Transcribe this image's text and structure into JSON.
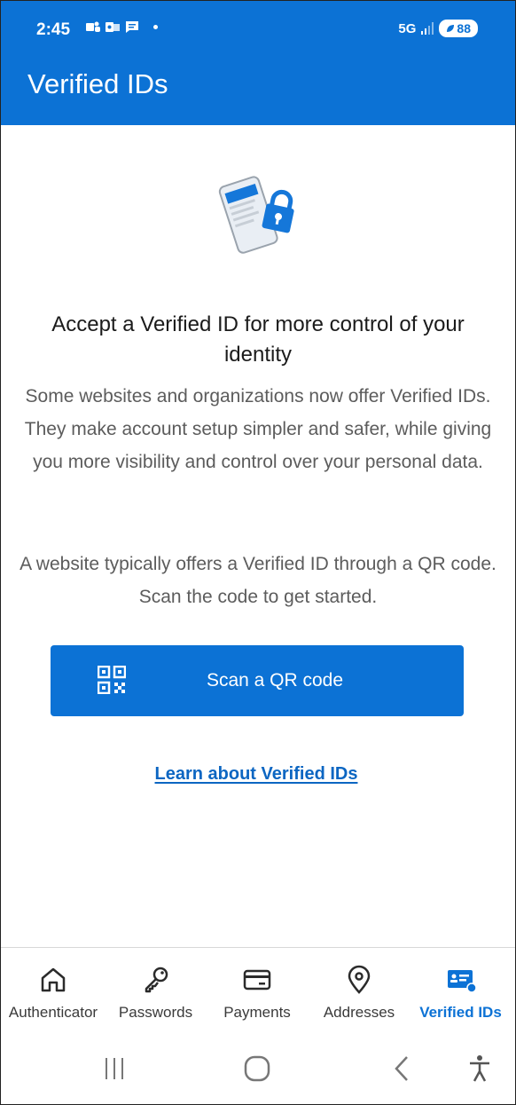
{
  "status_bar": {
    "time": "2:45",
    "network": "5G",
    "battery": "88",
    "notification_icons": [
      "teams-icon",
      "outlook-icon",
      "messages-icon"
    ]
  },
  "app_bar": {
    "title": "Verified IDs"
  },
  "main": {
    "heading": "Accept a Verified ID for more control of your identity",
    "paragraph_1": "Some websites and organizations now offer Verified IDs. They make account setup simpler and safer, while giving you more visibility and control over your personal data.",
    "paragraph_2": "A website typically offers a Verified ID through a QR code. Scan the code to get started.",
    "scan_button_label": "Scan a QR code",
    "learn_link": "Learn about Verified IDs"
  },
  "bottom_nav": {
    "items": [
      {
        "label": "Authenticator",
        "icon": "home-icon",
        "active": false
      },
      {
        "label": "Passwords",
        "icon": "key-icon",
        "active": false
      },
      {
        "label": "Payments",
        "icon": "credit-card-icon",
        "active": false
      },
      {
        "label": "Addresses",
        "icon": "location-pin-icon",
        "active": false
      },
      {
        "label": "Verified IDs",
        "icon": "id-card-icon",
        "active": true
      }
    ]
  },
  "system_nav": {
    "buttons": [
      "recent-apps-icon",
      "home-circle-icon",
      "back-icon",
      "accessibility-icon"
    ]
  },
  "colors": {
    "brand_blue": "#0c72d5",
    "link_blue": "#0c66c2",
    "body_text_gray": "#5c5c5c"
  }
}
